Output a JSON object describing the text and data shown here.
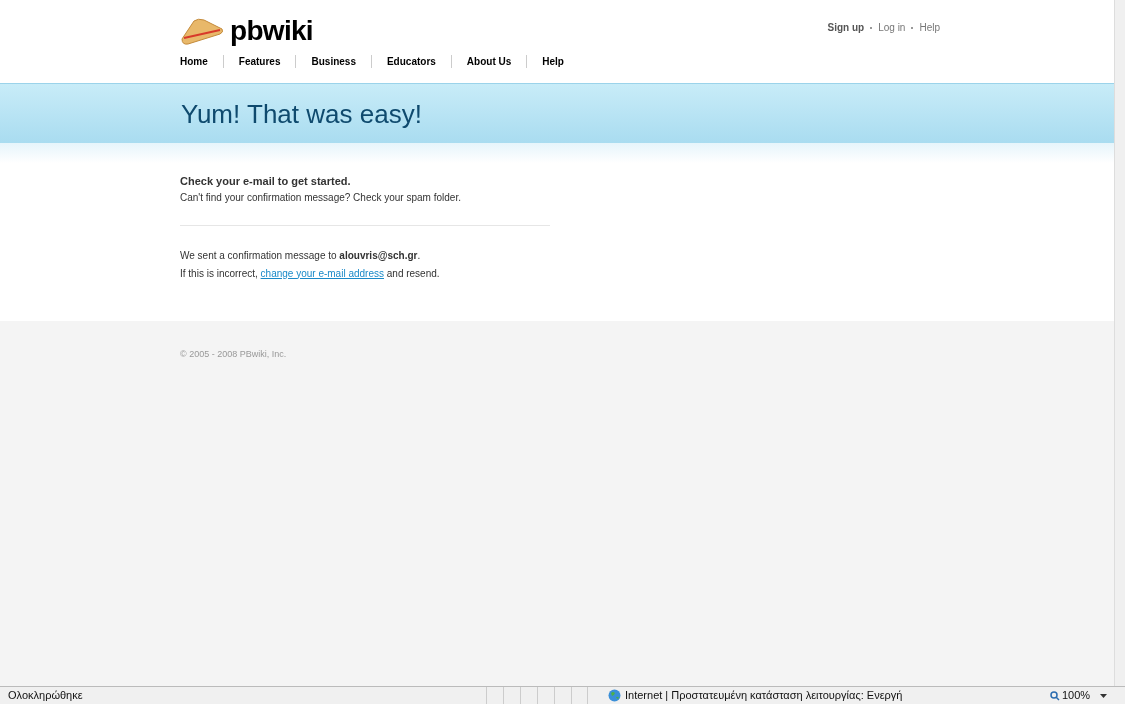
{
  "logo": {
    "text": "pbwiki"
  },
  "top_links": [
    {
      "label": "Sign up",
      "kind": "strong"
    },
    {
      "label": "Log in",
      "kind": "plain"
    },
    {
      "label": "Help",
      "kind": "plain"
    }
  ],
  "nav": [
    "Home",
    "Features",
    "Business",
    "Educators",
    "About Us",
    "Help"
  ],
  "banner": {
    "title": "Yum! That was easy!"
  },
  "message": {
    "heading": "Check your e-mail to get started.",
    "hint": "Can't find your confirmation message? Check your spam folder.",
    "sent": "We sent a confirmation message to **alouvris@sch.gr**.",
    "incorrect_before": "If this is incorrect, ",
    "incorrect_link": "change your e-mail address",
    "incorrect_after": " and resend."
  },
  "footer": {
    "copyright": "© 2005 - 2008 PBwiki, Inc."
  },
  "status_bar": {
    "status": "Ολοκληρώθηκε",
    "zone": "Internet | Προστατευμένη κατάσταση λειτουργίας: Ενεργή",
    "zoom": "100%"
  }
}
